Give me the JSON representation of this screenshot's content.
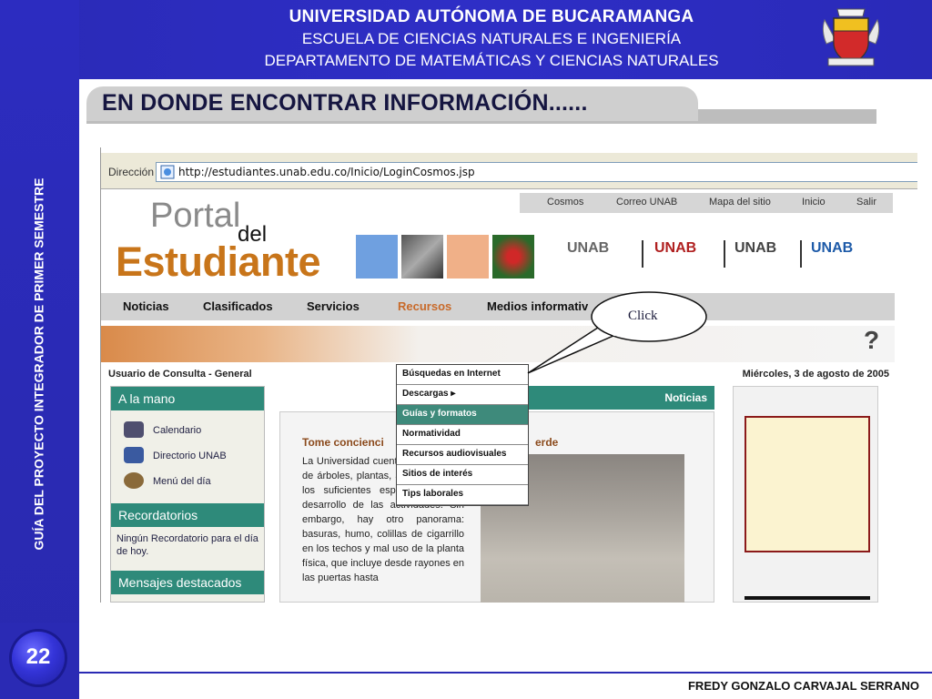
{
  "header": {
    "university": "UNIVERSIDAD AUTÓNOMA DE BUCARAMANGA",
    "school": "ESCUELA DE CIENCIAS NATURALES E INGENIERÍA",
    "department": "DEPARTAMENTO DE MATEMÁTICAS Y CIENCIAS NATURALES"
  },
  "sidebar": {
    "vertical_title": "GUÍA DEL PROYECTO INTEGRADOR DE PRIMER SEMESTRE",
    "page_number": "22"
  },
  "slide": {
    "title": "EN DONDE ENCONTRAR INFORMACIÓN......",
    "footer": "FREDY GONZALO CARVAJAL SERRANO",
    "callout": "Click"
  },
  "browser": {
    "address_label": "Dirección",
    "url": "http://estudiantes.unab.edu.co/Inicio/LoginCosmos.jsp"
  },
  "portal": {
    "logo_portal": "Portal",
    "logo_del": "del",
    "logo_estudiante": "Estudiante",
    "top_links": [
      "Cosmos",
      "Correo UNAB",
      "Mapa del sitio",
      "Inicio",
      "Salir"
    ],
    "brands": [
      "UNAB",
      "UNAB",
      "UNAB",
      "UNAB"
    ],
    "main_nav": [
      "Noticias",
      "Clasificados",
      "Servicios",
      "Recursos",
      "Medios informativ"
    ],
    "dropdown": [
      "Búsquedas en Internet",
      "Descargas ▸",
      "Guías y formatos",
      "Normatividad",
      "Recursos audiovisuales",
      "Sitios de interés",
      "Tips laborales"
    ],
    "user_line": "Usuario de Consulta - General",
    "date_line": "Miércoles, 3 de agosto de 2005",
    "a_la_mano": "A la mano",
    "a_la_mano_items": [
      "Calendario",
      "Directorio UNAB",
      "Menú del día"
    ],
    "recordatorios": "Recordatorios",
    "recordatorios_text": "Ningún Recordatorio para el día de hoy.",
    "mensajes": "Mensajes destacados",
    "noticias": "Noticias",
    "article_title": "Tome concienci",
    "article_title_tail": "erde",
    "article_body": "La Universidad cuenta con variedad de árboles, plantas, animales y con los suficientes espacios para el desarrollo de las actividades. Sin embargo, hay otro panorama: basuras, humo, colillas de cigarrillo en los techos y mal uso de la planta física, que incluye desde rayones en las puertas hasta"
  }
}
